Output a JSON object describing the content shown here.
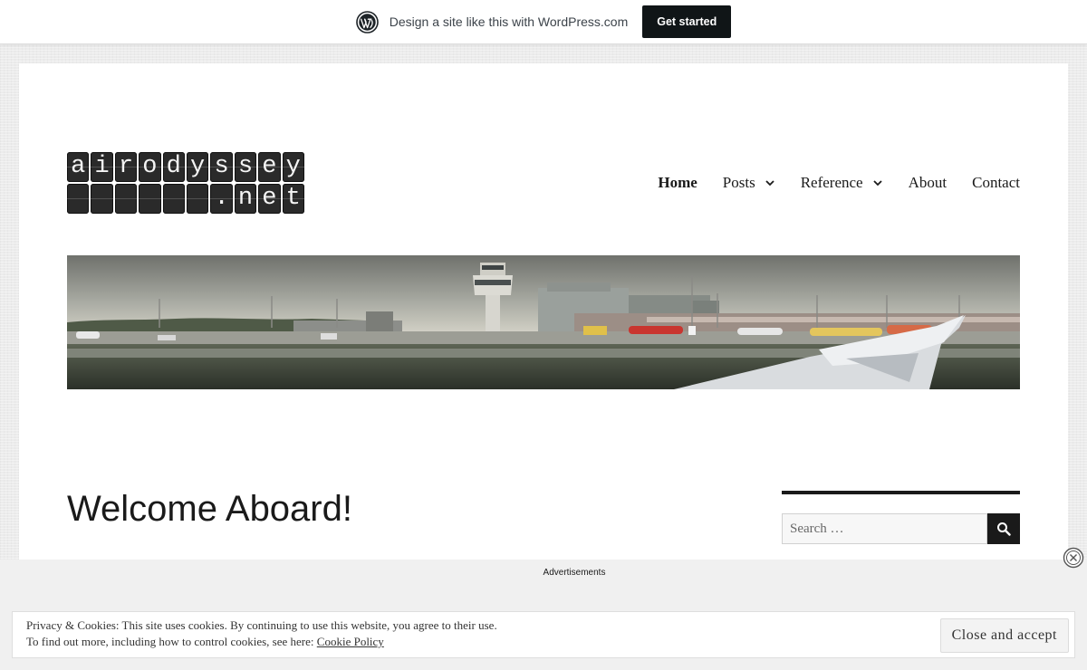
{
  "promo_bar": {
    "text": "Design a site like this with WordPress.com",
    "button_label": "Get started"
  },
  "logo": {
    "line1": [
      "a",
      "i",
      "r",
      "o",
      "d",
      "y",
      "s",
      "s",
      "e",
      "y"
    ],
    "line2": [
      "",
      "",
      "",
      "",
      "",
      "",
      ".",
      "n",
      "e",
      "t"
    ]
  },
  "nav": {
    "items": [
      {
        "label": "Home",
        "active": true,
        "has_submenu": false
      },
      {
        "label": "Posts",
        "active": false,
        "has_submenu": true
      },
      {
        "label": "Reference",
        "active": false,
        "has_submenu": true
      },
      {
        "label": "About",
        "active": false,
        "has_submenu": false
      },
      {
        "label": "Contact",
        "active": false,
        "has_submenu": false
      }
    ]
  },
  "header_image": {
    "icon": "airport-photo"
  },
  "main": {
    "title": "Welcome Aboard!"
  },
  "sidebar": {
    "search": {
      "placeholder": "Search …",
      "icon": "search-icon"
    }
  },
  "ads": {
    "label": "Advertisements"
  },
  "cookie_banner": {
    "line1": "Privacy & Cookies: This site uses cookies. By continuing to use this website, you agree to their use.",
    "line2_prefix": "To find out more, including how to control cookies, see here: ",
    "link_label": "Cookie Policy",
    "button_label": "Close and accept"
  },
  "colors": {
    "accent": "#1a1a1a",
    "promo_button": "#101517",
    "background": "#ececec"
  }
}
